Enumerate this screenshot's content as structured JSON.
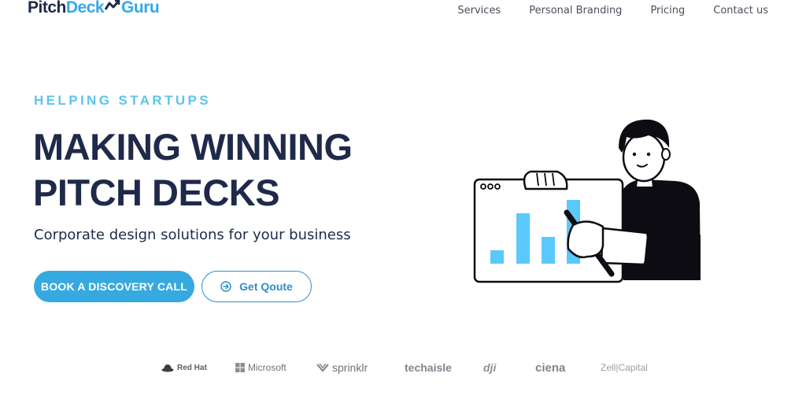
{
  "logo": {
    "part1": "Pitch",
    "part2": "Deck",
    "part3": "Guru"
  },
  "nav": {
    "items": [
      "Services",
      "Personal Branding",
      "Pricing",
      "Contact us"
    ]
  },
  "hero": {
    "eyebrow": "HELPING STARTUPS",
    "headline_line1": "MAKING WINNING",
    "headline_line2": "PITCH DECKS",
    "subtitle": "Corporate design solutions for your business",
    "primary_cta": "BOOK A DISCOVERY CALL",
    "secondary_cta": "Get Qoute"
  },
  "brands": {
    "redhat": "Red Hat",
    "microsoft": "Microsoft",
    "sprinklr": "sprinklr",
    "techaisle": "techaisle",
    "dji": "dji",
    "ciena": "ciena",
    "zell": "Zell|Capital"
  },
  "colors": {
    "navy": "#1f2a4a",
    "accent": "#36a9e1",
    "eyebrow": "#5cc4ee"
  },
  "icons": [
    "logo-chart-mark-icon",
    "arrow-circle-right-icon",
    "redhat-hat-icon",
    "microsoft-grid-icon",
    "sprinklr-mark-icon"
  ]
}
